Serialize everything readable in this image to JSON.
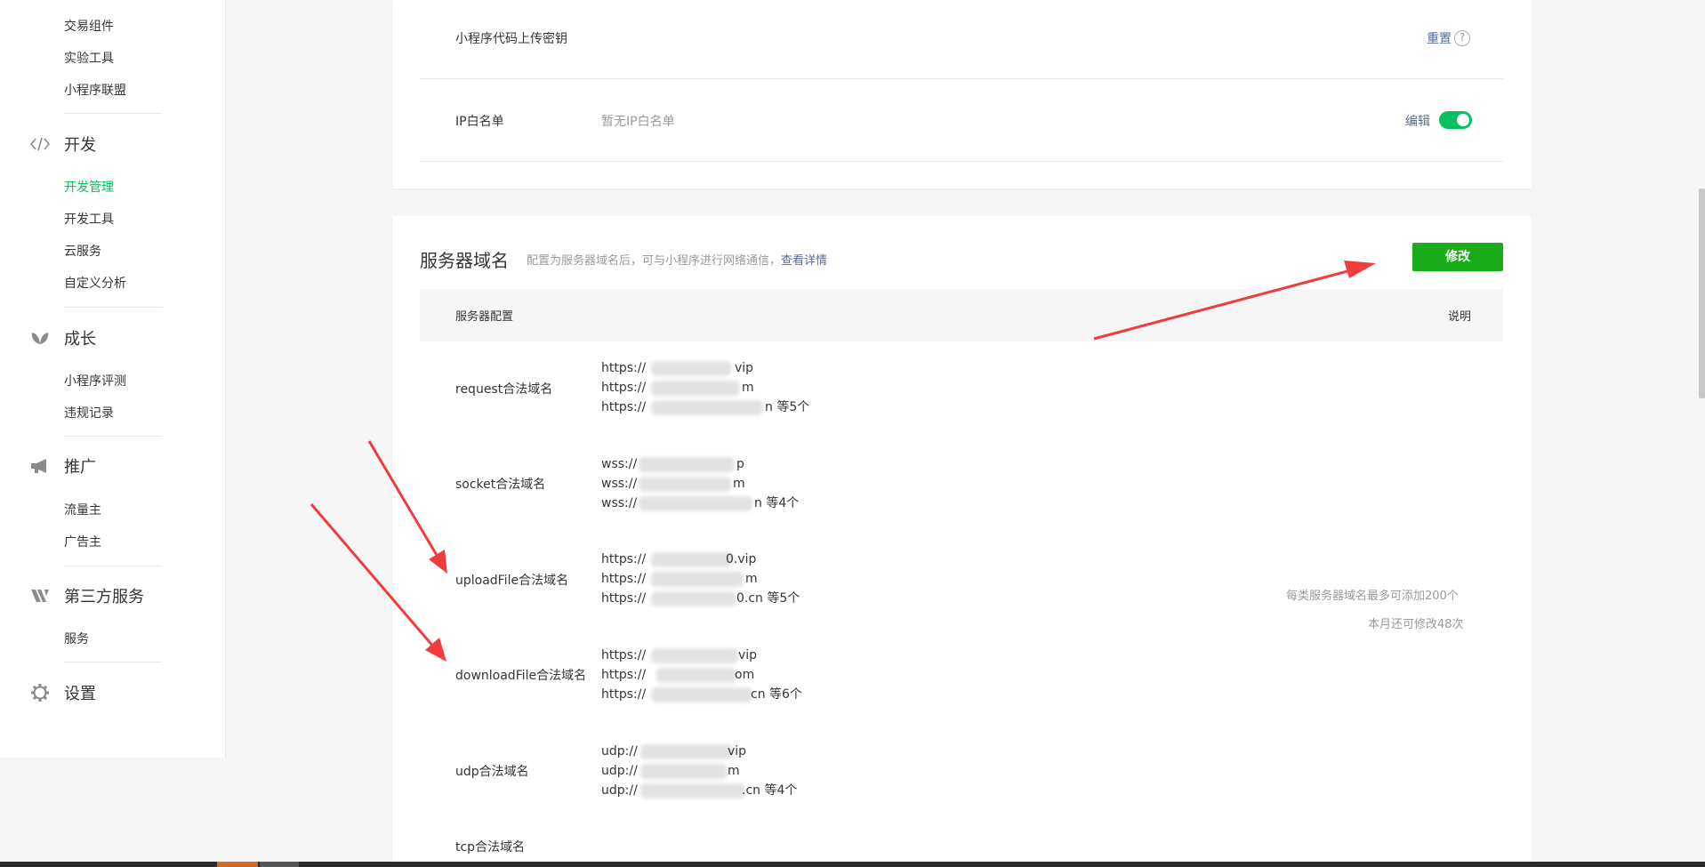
{
  "sidebar": {
    "top_items": [
      {
        "label": "交易组件"
      },
      {
        "label": "实验工具"
      },
      {
        "label": "小程序联盟"
      }
    ],
    "groups": [
      {
        "label": "开发",
        "icon": "code-icon",
        "items": [
          {
            "label": "开发管理",
            "active": true
          },
          {
            "label": "开发工具"
          },
          {
            "label": "云服务"
          },
          {
            "label": "自定义分析"
          }
        ]
      },
      {
        "label": "成长",
        "icon": "sprout-icon",
        "items": [
          {
            "label": "小程序评测"
          },
          {
            "label": "违规记录"
          }
        ]
      },
      {
        "label": "推广",
        "icon": "megaphone-icon",
        "items": [
          {
            "label": "流量主"
          },
          {
            "label": "广告主"
          }
        ]
      },
      {
        "label": "第三方服务",
        "icon": "third-party-icon",
        "items": [
          {
            "label": "服务"
          }
        ]
      },
      {
        "label": "设置",
        "icon": "gear-icon",
        "items": []
      }
    ]
  },
  "top_card": {
    "upload_key": {
      "label": "小程序代码上传密钥",
      "action": "重置",
      "help": "?"
    },
    "ip_whitelist": {
      "label": "IP白名单",
      "value": "暂无IP白名单",
      "action": "编辑",
      "toggle_on": true
    }
  },
  "server_domain": {
    "title": "服务器域名",
    "desc_prefix": "配置为服务器域名后，可与小程序进行网络通信，",
    "desc_link": "查看详情",
    "modify_button": "修改",
    "table_header": {
      "config": "服务器配置",
      "note": "说明"
    },
    "rows": [
      {
        "label": "request合法域名",
        "lines": [
          {
            "prefix": "https://",
            "suffix": "vip"
          },
          {
            "prefix": "https://",
            "suffix": "m"
          },
          {
            "prefix": "https://",
            "suffix": "n 等5个"
          }
        ]
      },
      {
        "label": "socket合法域名",
        "lines": [
          {
            "prefix": "wss://",
            "suffix": "p"
          },
          {
            "prefix": "wss://",
            "suffix": "m"
          },
          {
            "prefix": "wss://",
            "suffix": "n 等4个"
          }
        ]
      },
      {
        "label": "uploadFile合法域名",
        "lines": [
          {
            "prefix": "https://",
            "suffix": "0.vip"
          },
          {
            "prefix": "https://",
            "suffix": "m"
          },
          {
            "prefix": "https://",
            "suffix": "0.cn 等5个"
          }
        ]
      },
      {
        "label": "downloadFile合法域名",
        "lines": [
          {
            "prefix": "https://",
            "suffix": "vip"
          },
          {
            "prefix": "https://",
            "suffix": "om"
          },
          {
            "prefix": "https://",
            "suffix": "cn 等6个"
          }
        ]
      },
      {
        "label": "udp合法域名",
        "lines": [
          {
            "prefix": "udp://",
            "suffix": "vip"
          },
          {
            "prefix": "udp://",
            "suffix": "m"
          },
          {
            "prefix": "udp://",
            "suffix": ".cn 等4个"
          }
        ]
      },
      {
        "label": "tcp合法域名",
        "lines": []
      }
    ],
    "notes": [
      "每类服务器域名最多可添加200个",
      "本月还可修改48次"
    ]
  },
  "colors": {
    "accent": "#07c160",
    "button": "#1aad19",
    "link": "#576b95",
    "arrow": "#f03c3c"
  }
}
